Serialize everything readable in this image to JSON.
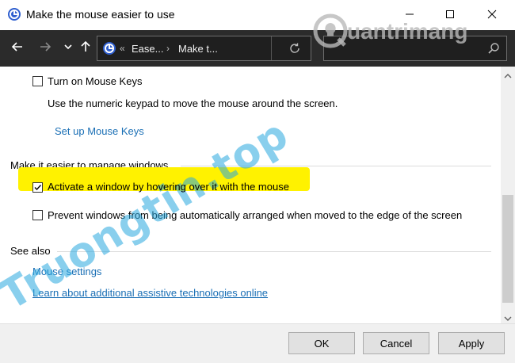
{
  "window": {
    "title": "Make the mouse easier to use",
    "minimize_icon": "minimize-icon",
    "maximize_icon": "maximize-icon",
    "close_icon": "close-icon"
  },
  "navbar": {
    "back_icon": "arrow-left-icon",
    "forward_icon": "arrow-right-icon",
    "recent_icon": "chevron-down-icon",
    "up_icon": "arrow-up-icon",
    "address": {
      "overflow": "«",
      "crumbs": [
        "Ease...",
        "Make t..."
      ],
      "refresh_icon": "refresh-icon"
    },
    "search_icon": "search-icon"
  },
  "content": {
    "mouse_keys": {
      "checkbox_label": "Turn on Mouse Keys",
      "checked": false,
      "description": "Use the numeric keypad to move the mouse around the screen.",
      "setup_link": "Set up Mouse Keys"
    },
    "windows_section": {
      "heading": "Make it easier to manage windows",
      "options": [
        {
          "label": "Activate a window by hovering over it with the mouse",
          "checked": true
        },
        {
          "label": "Prevent windows from being automatically arranged when moved to the edge of the screen",
          "checked": false
        }
      ]
    },
    "see_also": {
      "heading": "See also",
      "links": [
        "Mouse settings",
        "Learn about additional assistive technologies online"
      ]
    }
  },
  "footer": {
    "ok": "OK",
    "cancel": "Cancel",
    "apply": "Apply"
  },
  "watermarks": {
    "top": "uantrimang",
    "diagonal": "Truongtin.top"
  },
  "colors": {
    "highlight": "#fff200",
    "link": "#1a6fb5",
    "navbar": "#2b2b2b"
  }
}
